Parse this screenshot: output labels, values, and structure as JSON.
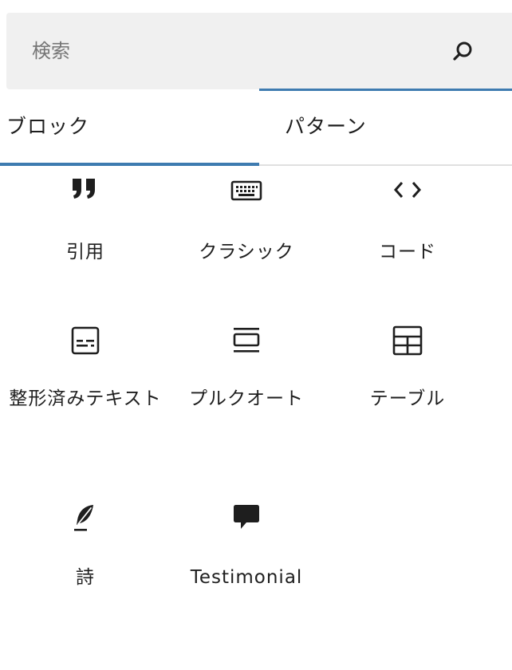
{
  "search": {
    "placeholder": "検索",
    "value": ""
  },
  "tabs": [
    {
      "label": "ブロック",
      "active": true
    },
    {
      "label": "パターン",
      "active": false
    }
  ],
  "blocks": [
    {
      "label": "引用",
      "icon": "quote-icon"
    },
    {
      "label": "クラシック",
      "icon": "keyboard-icon"
    },
    {
      "label": "コード",
      "icon": "code-icon"
    },
    {
      "label": "整形済みテキスト",
      "icon": "preformatted-icon"
    },
    {
      "label": "プルクオート",
      "icon": "pullquote-icon"
    },
    {
      "label": "テーブル",
      "icon": "table-icon"
    },
    {
      "label": "詩",
      "icon": "verse-icon"
    },
    {
      "label": "Testimonial",
      "icon": "testimonial-icon"
    }
  ],
  "colors": {
    "accent": "#3e7bb0",
    "search_bg": "#f0f0f0",
    "text": "#1e1e1e",
    "placeholder": "#757575",
    "divider": "#e0e0e0"
  }
}
